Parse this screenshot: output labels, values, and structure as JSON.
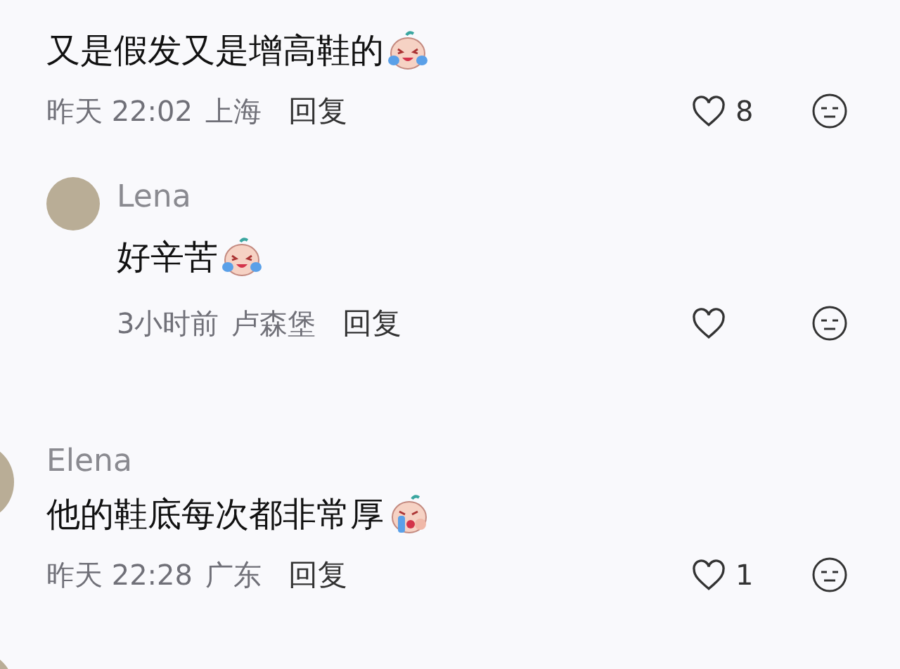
{
  "comments": [
    {
      "avatar": false,
      "text": "又是假发又是增高鞋的",
      "emoji": {
        "kind": "laughcry"
      },
      "time": "昨天 22:02",
      "location": "上海",
      "reply": "回复",
      "likes": "8",
      "replies": [
        {
          "avatar": true,
          "name": "Lena",
          "text": "好辛苦",
          "emoji": {
            "kind": "laughcry"
          },
          "time": "3小时前",
          "location": "卢森堡",
          "reply": "回复"
        }
      ]
    },
    {
      "avatar": true,
      "name": "Elena",
      "text": "他的鞋底每次都非常厚",
      "emoji": {
        "kind": "cry"
      },
      "time": "昨天 22:28",
      "location": "广东",
      "reply": "回复",
      "likes": "1"
    },
    {
      "avatar": true
    }
  ]
}
